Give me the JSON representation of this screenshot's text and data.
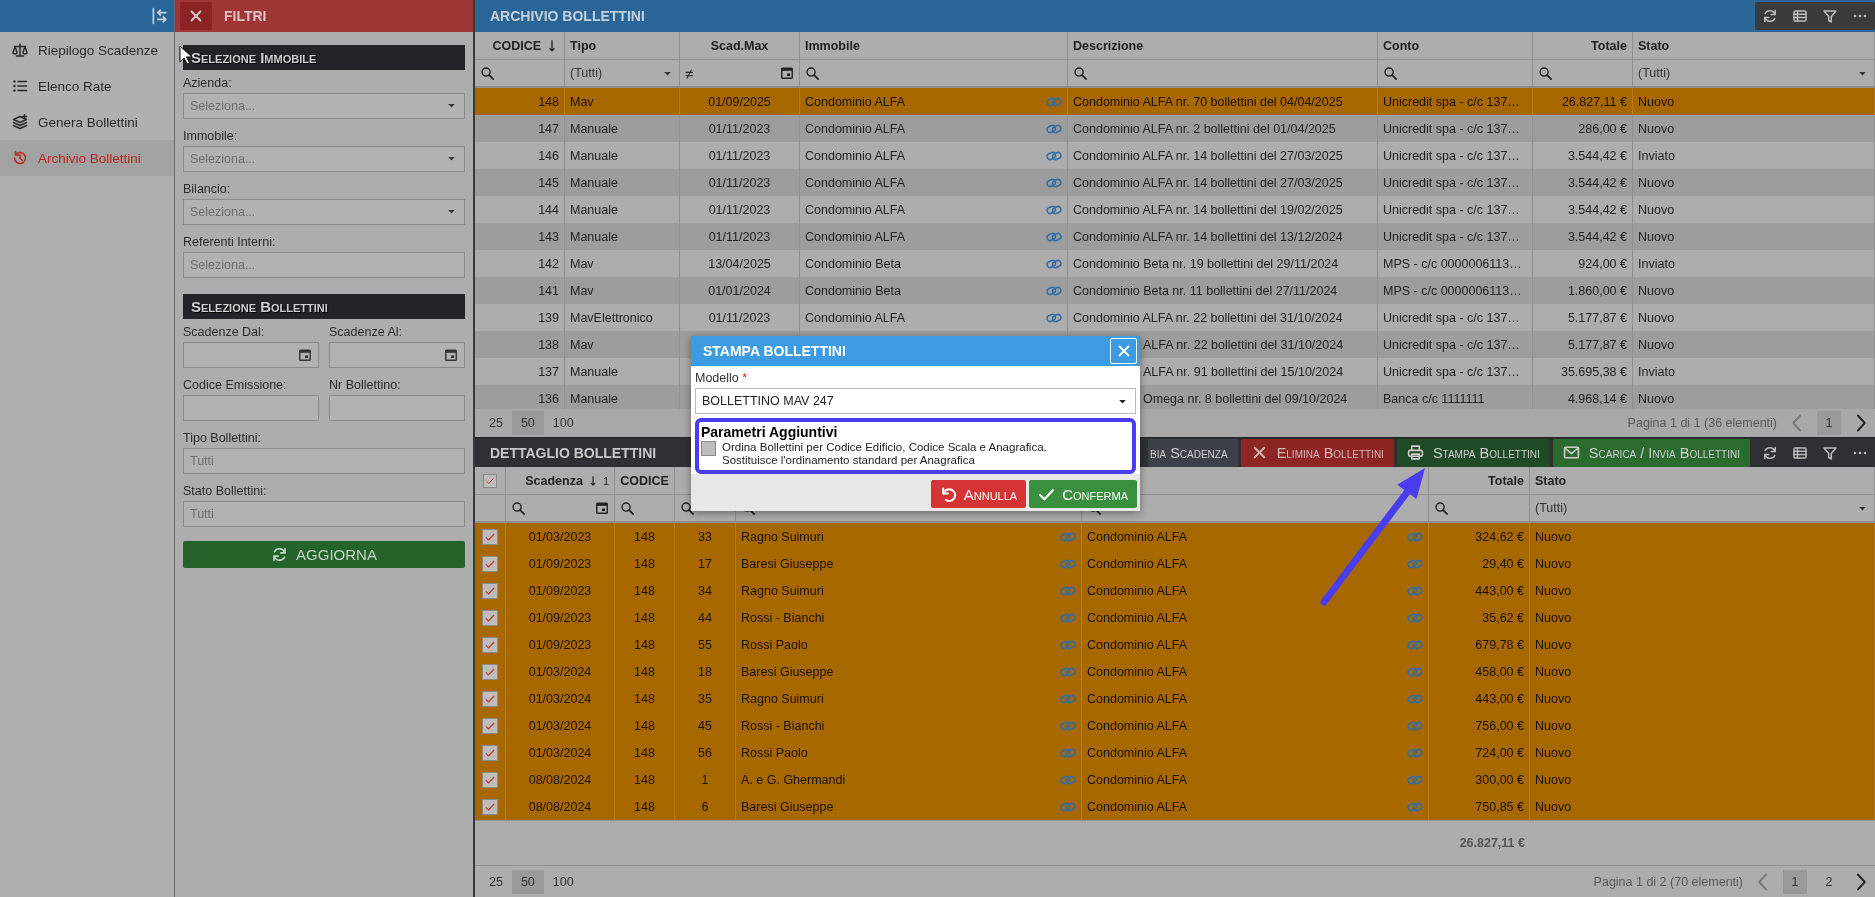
{
  "sidebar": {
    "items": [
      {
        "label": "Riepilogo Scadenze",
        "selected": false
      },
      {
        "label": "Elenco Rate",
        "selected": false
      },
      {
        "label": "Genera Bollettini",
        "selected": false
      },
      {
        "label": "Archivio Bollettini",
        "selected": true
      }
    ]
  },
  "filters": {
    "title": "FILTRI",
    "sections": [
      {
        "title": "Selezione Immobile",
        "rows": [
          [
            {
              "label": "Azienda:",
              "kind": "select",
              "placeholder": "Seleziona..."
            }
          ],
          [
            {
              "label": "Immobile:",
              "kind": "select",
              "placeholder": "Seleziona..."
            }
          ],
          [
            {
              "label": "Bilancio:",
              "kind": "select",
              "placeholder": "Seleziona..."
            }
          ],
          [
            {
              "label": "Referenti Interni:",
              "kind": "text",
              "placeholder": "Seleziona..."
            }
          ]
        ]
      },
      {
        "title": "Selezione Bollettini",
        "rows": [
          [
            {
              "label": "Scadenze Dal:",
              "kind": "date"
            },
            {
              "label": "Scadenze Al:",
              "kind": "date"
            }
          ],
          [
            {
              "label": "Codice Emissione:",
              "kind": "text"
            },
            {
              "label": "Nr Bollettino:",
              "kind": "text"
            }
          ],
          [
            {
              "label": "Tipo Bollettini:",
              "kind": "text",
              "placeholder": "Tutti"
            }
          ],
          [
            {
              "label": "Stato Bollettini:",
              "kind": "text",
              "placeholder": "Tutti"
            }
          ]
        ]
      }
    ],
    "button": "AGGIORNA"
  },
  "archive": {
    "title": "ARCHIVIO BOLLETTINI",
    "columns": [
      "CODICE",
      "Tipo",
      "Scad.Max",
      "Immobile",
      "Descrizione",
      "Conto",
      "Totale",
      "Stato"
    ],
    "filters": [
      {
        "kind": "search"
      },
      {
        "kind": "dropdown",
        "value": "(Tutti)"
      },
      {
        "kind": "date",
        "operator": "≠"
      },
      {
        "kind": "search"
      },
      {
        "kind": "search"
      },
      {
        "kind": "search"
      },
      {
        "kind": "search"
      },
      {
        "kind": "dropdown",
        "value": "(Tutti)"
      }
    ],
    "rows": [
      {
        "codice": "148",
        "tipo": "Mav",
        "scad_max": "01/09/2025",
        "immobile": "Condominio ALFA",
        "descrizione": "Condominio ALFA nr. 70 bollettini del 04/04/2025",
        "conto": "Unicredit spa - c/c 137…",
        "totale": "26.827,11 €",
        "stato": "Nuovo",
        "selected": true
      },
      {
        "codice": "147",
        "tipo": "Manuale",
        "scad_max": "01/11/2023",
        "immobile": "Condominio ALFA",
        "descrizione": "Condominio ALFA nr. 2 bollettini del 01/04/2025",
        "conto": "Unicredit spa - c/c 137…",
        "totale": "286,00 €",
        "stato": "Nuovo",
        "selected": false
      },
      {
        "codice": "146",
        "tipo": "Manuale",
        "scad_max": "01/11/2023",
        "immobile": "Condominio ALFA",
        "descrizione": "Condominio ALFA nr. 14 bollettini del 27/03/2025",
        "conto": "Unicredit spa - c/c 137…",
        "totale": "3.544,42 €",
        "stato": "Inviato",
        "selected": false
      },
      {
        "codice": "145",
        "tipo": "Manuale",
        "scad_max": "01/11/2023",
        "immobile": "Condominio ALFA",
        "descrizione": "Condominio ALFA nr. 14 bollettini del 27/03/2025",
        "conto": "Unicredit spa - c/c 137…",
        "totale": "3.544,42 €",
        "stato": "Nuovo",
        "selected": false
      },
      {
        "codice": "144",
        "tipo": "Manuale",
        "scad_max": "01/11/2023",
        "immobile": "Condominio ALFA",
        "descrizione": "Condominio ALFA nr. 14 bollettini del 19/02/2025",
        "conto": "Unicredit spa - c/c 137…",
        "totale": "3.544,42 €",
        "stato": "Nuovo",
        "selected": false
      },
      {
        "codice": "143",
        "tipo": "Manuale",
        "scad_max": "01/11/2023",
        "immobile": "Condominio ALFA",
        "descrizione": "Condominio ALFA nr. 14 bollettini del 13/12/2024",
        "conto": "Unicredit spa - c/c 137…",
        "totale": "3.544,42 €",
        "stato": "Nuovo",
        "selected": false
      },
      {
        "codice": "142",
        "tipo": "Mav",
        "scad_max": "13/04/2025",
        "immobile": "Condominio Beta",
        "descrizione": "Condominio Beta nr. 19 bollettini del 29/11/2024",
        "conto": "MPS - c/c 0000006113…",
        "totale": "924,00 €",
        "stato": "Inviato",
        "selected": false
      },
      {
        "codice": "141",
        "tipo": "Mav",
        "scad_max": "01/01/2024",
        "immobile": "Condominio Beta",
        "descrizione": "Condominio Beta nr. 11 bollettini del 27/11/2024",
        "conto": "MPS - c/c 0000006113…",
        "totale": "1.860,00 €",
        "stato": "Nuovo",
        "selected": false
      },
      {
        "codice": "139",
        "tipo": "MavElettronico",
        "scad_max": "01/11/2023",
        "immobile": "Condominio ALFA",
        "descrizione": "Condominio ALFA nr. 22 bollettini del 31/10/2024",
        "conto": "Unicredit spa - c/c 137…",
        "totale": "5.177,87 €",
        "stato": "Nuovo",
        "selected": false
      },
      {
        "codice": "138",
        "tipo": "Mav",
        "descrizione": "ALFA nr. 22 bollettini del 31/10/2024",
        "conto": "Unicredit spa - c/c 137…",
        "totale": "5.177,87 €",
        "stato": "Nuovo",
        "selected": false
      },
      {
        "codice": "137",
        "tipo": "Manuale",
        "descrizione": "ALFA nr. 91 bollettini del 15/10/2024",
        "conto": "Unicredit spa - c/c 137…",
        "totale": "35.695,38 €",
        "stato": "Inviato",
        "selected": false
      },
      {
        "codice": "136",
        "tipo": "Manuale",
        "descrizione": "Omega nr. 8 bollettini del 09/10/2024",
        "conto": "Banca c/c 1111111",
        "totale": "4.968,14 €",
        "stato": "Nuovo",
        "selected": false
      }
    ],
    "pager": {
      "page_sizes": [
        {
          "label": "25",
          "selected": false
        },
        {
          "label": "50",
          "selected": true
        },
        {
          "label": "100",
          "selected": false
        }
      ],
      "info": "Pagina 1 di 1 (36 elementi)",
      "pages": [
        {
          "label": "1",
          "selected": true
        }
      ]
    }
  },
  "detail": {
    "title": "DETTAGLIO BOLLETTINI",
    "buttons": [
      {
        "label": "bia Scadenza",
        "kind": "plain"
      },
      {
        "label": "Elimina Bollettini",
        "kind": "delete"
      },
      {
        "label": "Stampa Bollettini",
        "kind": "print"
      },
      {
        "label": "Scarica / Invia Bollettini",
        "kind": "send"
      }
    ],
    "header_checked": true,
    "columns": {
      "scadenza": {
        "label": "Scadenza",
        "sort_order": "1"
      },
      "codice": {
        "label": "CODICE"
      },
      "totale": {
        "label": "Totale"
      },
      "stato": {
        "label": "Stato"
      }
    },
    "filters": {
      "scadenza": {
        "kind": "search_date"
      },
      "codice": {
        "kind": "search"
      },
      "nr": {
        "kind": "search"
      },
      "nominativo": {
        "kind": "search"
      },
      "immobile": {
        "kind": "search"
      },
      "totale": {
        "kind": "search"
      },
      "stato": {
        "kind": "dropdown",
        "value": "(Tutti)"
      }
    },
    "rows": [
      {
        "checked": true,
        "selected": true,
        "scadenza": "01/03/2023",
        "codice": "148",
        "nr": "33",
        "nominativo": "Ragno Suimuri",
        "immobile": "Condominio ALFA",
        "totale": "324,62 €",
        "stato": "Nuovo"
      },
      {
        "checked": true,
        "selected": true,
        "scadenza": "01/09/2023",
        "codice": "148",
        "nr": "17",
        "nominativo": "Baresi Giuseppe",
        "immobile": "Condominio ALFA",
        "totale": "29,40 €",
        "stato": "Nuovo"
      },
      {
        "checked": true,
        "selected": true,
        "scadenza": "01/09/2023",
        "codice": "148",
        "nr": "34",
        "nominativo": "Ragno Suimuri",
        "immobile": "Condominio ALFA",
        "totale": "443,00 €",
        "stato": "Nuovo"
      },
      {
        "checked": true,
        "selected": true,
        "scadenza": "01/09/2023",
        "codice": "148",
        "nr": "44",
        "nominativo": "Rossi - Bianchi",
        "immobile": "Condominio ALFA",
        "totale": "35,62 €",
        "stato": "Nuovo"
      },
      {
        "checked": true,
        "selected": true,
        "scadenza": "01/09/2023",
        "codice": "148",
        "nr": "55",
        "nominativo": "Rossi Paolo",
        "immobile": "Condominio ALFA",
        "totale": "679,78 €",
        "stato": "Nuovo"
      },
      {
        "checked": true,
        "selected": true,
        "scadenza": "01/03/2024",
        "codice": "148",
        "nr": "18",
        "nominativo": "Baresi Giuseppe",
        "immobile": "Condominio ALFA",
        "totale": "458,00 €",
        "stato": "Nuovo"
      },
      {
        "checked": true,
        "selected": true,
        "scadenza": "01/03/2024",
        "codice": "148",
        "nr": "35",
        "nominativo": "Ragno Suimuri",
        "immobile": "Condominio ALFA",
        "totale": "443,00 €",
        "stato": "Nuovo"
      },
      {
        "checked": true,
        "selected": true,
        "scadenza": "01/03/2024",
        "codice": "148",
        "nr": "45",
        "nominativo": "Rossi - Bianchi",
        "immobile": "Condominio ALFA",
        "totale": "756,00 €",
        "stato": "Nuovo"
      },
      {
        "checked": true,
        "selected": true,
        "scadenza": "01/03/2024",
        "codice": "148",
        "nr": "56",
        "nominativo": "Rossi Paolo",
        "immobile": "Condominio ALFA",
        "totale": "724,00 €",
        "stato": "Nuovo"
      },
      {
        "checked": true,
        "selected": true,
        "scadenza": "08/08/2024",
        "codice": "148",
        "nr": "1",
        "nominativo": "A. e G. Ghermandi",
        "immobile": "Condominio ALFA",
        "totale": "300,00 €",
        "stato": "Nuovo"
      },
      {
        "checked": true,
        "selected": true,
        "scadenza": "08/08/2024",
        "codice": "148",
        "nr": "6",
        "nominativo": "Baresi Giuseppe",
        "immobile": "Condominio ALFA",
        "totale": "750,85 €",
        "stato": "Nuovo"
      }
    ],
    "total": "26.827,11 €",
    "pager": {
      "page_sizes": [
        {
          "label": "25",
          "selected": false
        },
        {
          "label": "50",
          "selected": true
        },
        {
          "label": "100",
          "selected": false
        }
      ],
      "info": "Pagina 1 di 2 (70 elementi)",
      "pages": [
        {
          "label": "1",
          "selected": true
        },
        {
          "label": "2",
          "selected": false
        }
      ]
    }
  },
  "dialog": {
    "title": "STAMPA BOLLETTINI",
    "field": {
      "label": "Modello",
      "required_mark": "*",
      "value": "BOLLETTINO MAV 247"
    },
    "parameters": {
      "title": "Parametri Aggiuntivi",
      "option": {
        "label": "Ordina Bollettini per Codice Edificio, Codice Scala e Anagrafica.\nSostituisce l'ordinamento standard per Anagrafica",
        "checked": false
      }
    },
    "buttons": [
      {
        "label": "Annulla",
        "kind": "cancel"
      },
      {
        "label": "Conferma",
        "kind": "confirm"
      }
    ]
  }
}
